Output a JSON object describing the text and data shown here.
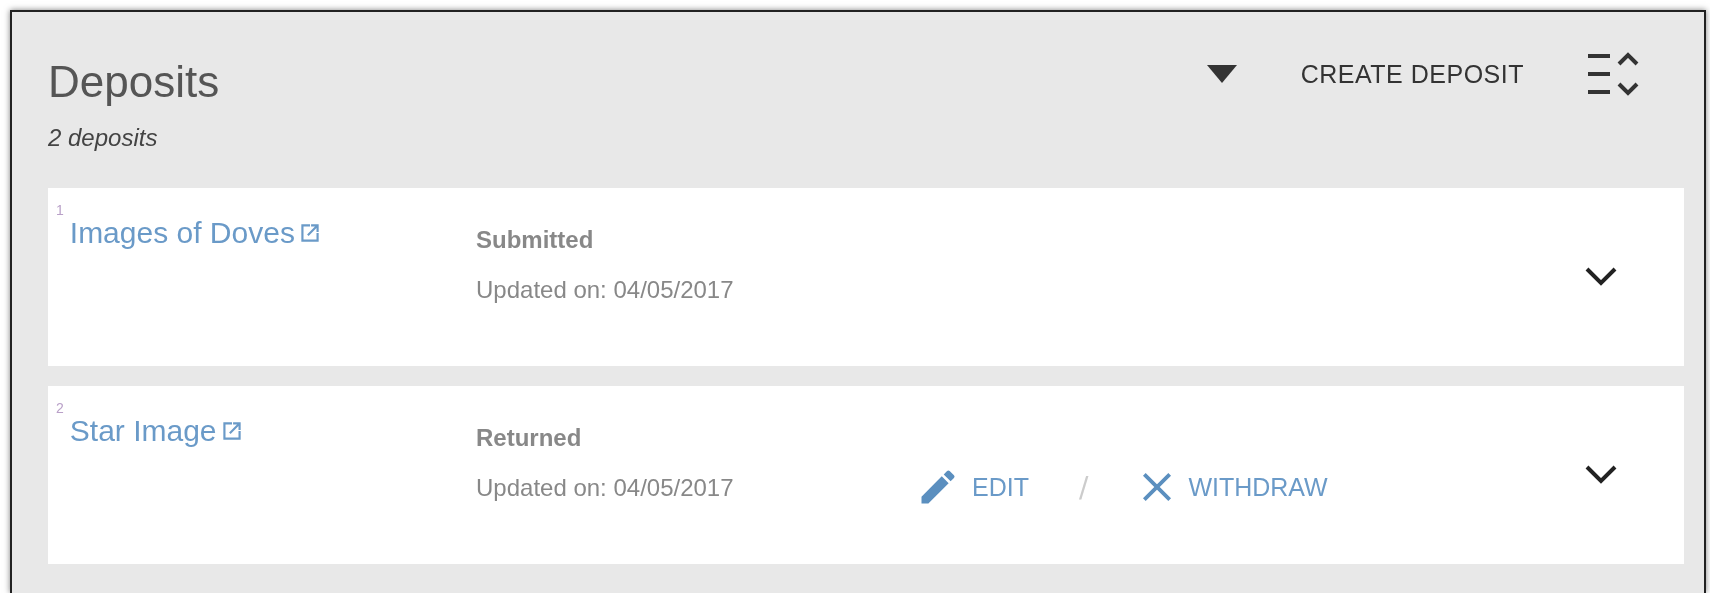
{
  "header": {
    "title": "Deposits",
    "count": "2 deposits",
    "create_button": "CREATE DEPOSIT"
  },
  "deposits": [
    {
      "index": "1",
      "title": "Images of Doves",
      "status": "Submitted",
      "updated": "Updated on: 04/05/2017",
      "expanded": false
    },
    {
      "index": "2",
      "title": "Star Image",
      "status": "Returned",
      "updated": "Updated on: 04/05/2017",
      "expanded": false,
      "separator": "/",
      "actions": [
        {
          "kind": "edit",
          "label": "EDIT"
        },
        {
          "kind": "withdraw",
          "label": "WITHDRAW"
        }
      ]
    }
  ]
}
